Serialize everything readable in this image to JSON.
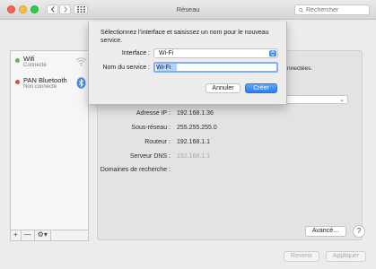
{
  "window": {
    "title": "Réseau"
  },
  "search": {
    "placeholder": "Rechercher"
  },
  "sidebar": {
    "items": [
      {
        "name": "Wifi",
        "status": "Connecté",
        "status_color": "#5bb84a",
        "icon": "wifi-icon"
      },
      {
        "name": "PAN Bluetooth",
        "status": "Non connecté",
        "status_color": "#e8463c",
        "icon": "bluetooth-icon"
      }
    ],
    "bottom_buttons": [
      "+",
      "—",
      "⚙▾"
    ]
  },
  "panel": {
    "partial_status": "nnectées.",
    "rows": [
      {
        "label": "Adresse IP :",
        "value": "192.168.1.36"
      },
      {
        "label": "Sous-réseau :",
        "value": "255.255.255.0"
      },
      {
        "label": "Routeur :",
        "value": "192.168.1.1"
      },
      {
        "label": "Serveur DNS :",
        "value": "192.168.1.1"
      },
      {
        "label": "Domaines de recherche :",
        "value": ""
      }
    ],
    "advanced_label": "Avancé…",
    "help_label": "?"
  },
  "footer": {
    "revert_label": "Revenir",
    "apply_label": "Appliquer"
  },
  "sheet": {
    "prompt": "Sélectionnez l’interface et saisissez un nom pour le nouveau service.",
    "interface_label": "Interface :",
    "interface_value": "Wi-Fi",
    "service_label": "Nom du service :",
    "service_value": "Wi-Fi",
    "cancel_label": "Annuler",
    "create_label": "Créer"
  },
  "colors": {
    "accent": "#2c7cf1",
    "focus_ring": "#7fb0f7"
  }
}
